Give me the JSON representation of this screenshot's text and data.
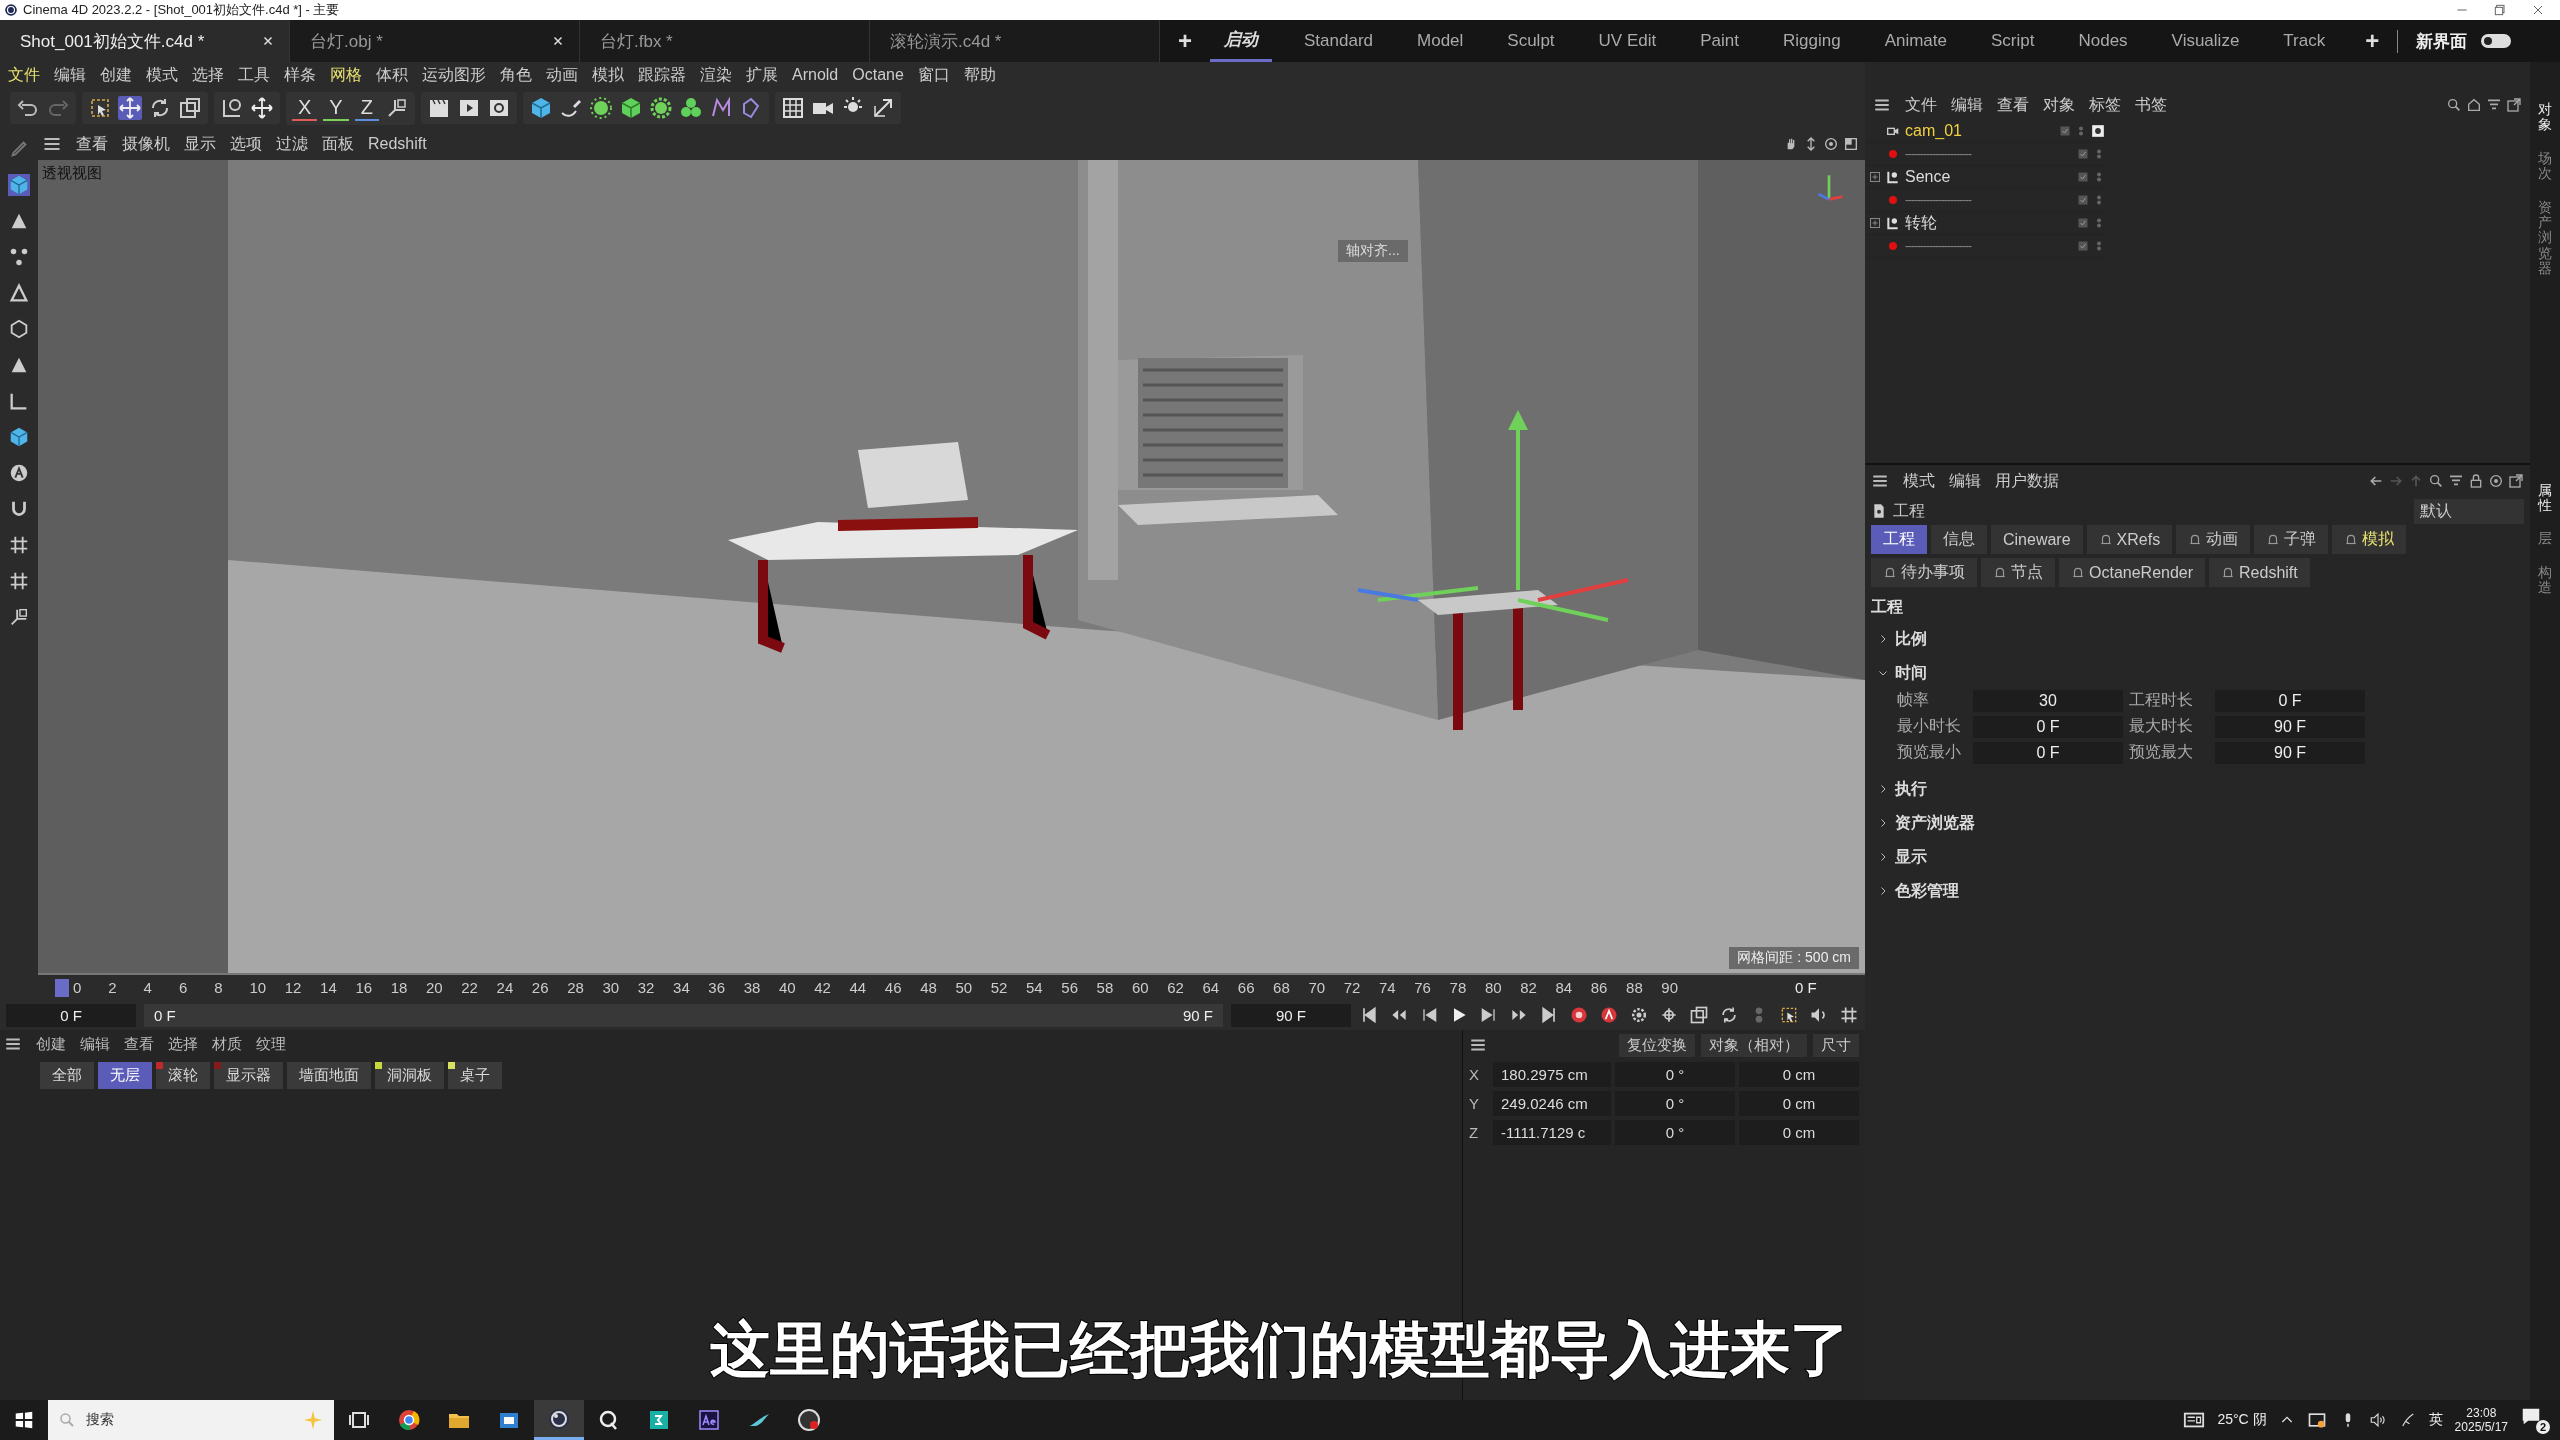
{
  "window": {
    "title": "Cinema 4D 2023.2.2 - [Shot_001初始文件.c4d *] - 主要"
  },
  "doc_tabs": [
    {
      "label": "Shot_001初始文件.c4d *",
      "selected": true,
      "closable": true
    },
    {
      "label": "台灯.obj *",
      "selected": false,
      "closable": true
    },
    {
      "label": "台灯.fbx *",
      "selected": false,
      "closable": false
    },
    {
      "label": "滚轮演示.c4d *",
      "selected": false,
      "closable": false
    }
  ],
  "new_tab": "+",
  "layouts": [
    {
      "label": "启动",
      "selected": true
    },
    {
      "label": "Standard",
      "selected": false
    },
    {
      "label": "Model",
      "selected": false
    },
    {
      "label": "Sculpt",
      "selected": false
    },
    {
      "label": "UV Edit",
      "selected": false
    },
    {
      "label": "Paint",
      "selected": false
    },
    {
      "label": "Rigging",
      "selected": false
    },
    {
      "label": "Animate",
      "selected": false
    },
    {
      "label": "Script",
      "selected": false
    },
    {
      "label": "Nodes",
      "selected": false
    },
    {
      "label": "Visualize",
      "selected": false
    },
    {
      "label": "Track",
      "selected": false
    }
  ],
  "add_layout": "+",
  "new_ui": {
    "label": "新界面",
    "on": false
  },
  "menu": [
    {
      "label": "文件",
      "highlighted": true
    },
    {
      "label": "编辑",
      "highlighted": false
    },
    {
      "label": "创建",
      "highlighted": false
    },
    {
      "label": "模式",
      "highlighted": false
    },
    {
      "label": "选择",
      "highlighted": false
    },
    {
      "label": "工具",
      "highlighted": false
    },
    {
      "label": "样条",
      "highlighted": false
    },
    {
      "label": "网格",
      "highlighted": true
    },
    {
      "label": "体积",
      "highlighted": false
    },
    {
      "label": "运动图形",
      "highlighted": false
    },
    {
      "label": "角色",
      "highlighted": false
    },
    {
      "label": "动画",
      "highlighted": false
    },
    {
      "label": "模拟",
      "highlighted": false
    },
    {
      "label": "跟踪器",
      "highlighted": false
    },
    {
      "label": "渲染",
      "highlighted": false
    },
    {
      "label": "扩展",
      "highlighted": false
    },
    {
      "label": "Arnold",
      "highlighted": false
    },
    {
      "label": "Octane",
      "highlighted": false
    },
    {
      "label": "窗口",
      "highlighted": false
    },
    {
      "label": "帮助",
      "highlighted": false
    }
  ],
  "axis_buttons": [
    {
      "label": "X",
      "color": "#e05a5a"
    },
    {
      "label": "Y",
      "color": "#7ccf5a"
    },
    {
      "label": "Z",
      "color": "#5a8ee0"
    }
  ],
  "viewport": {
    "menu": [
      "查看",
      "摄像机",
      "显示",
      "选项",
      "过滤",
      "面板",
      "Redshift"
    ],
    "view_name": "透视视图",
    "hint": "轴对齐...",
    "grid_spacing": "网格间距 : 500 cm"
  },
  "timeline": {
    "ticks": [
      "0",
      "2",
      "4",
      "6",
      "8",
      "10",
      "12",
      "14",
      "16",
      "18",
      "20",
      "22",
      "24",
      "26",
      "28",
      "30",
      "32",
      "34",
      "36",
      "38",
      "40",
      "42",
      "44",
      "46",
      "48",
      "50",
      "52",
      "54",
      "56",
      "58",
      "60",
      "62",
      "64",
      "66",
      "68",
      "70",
      "72",
      "74",
      "76",
      "78",
      "80",
      "82",
      "84",
      "86",
      "88",
      "90"
    ],
    "current_frame": "0 F",
    "start": "0 F",
    "range_bar": {
      "level": 1
    },
    "range_start": "0 F",
    "range_end": "90 F",
    "end": "90 F"
  },
  "layers": {
    "menu": [
      "创建",
      "编辑",
      "查看",
      "选择",
      "材质",
      "纹理"
    ],
    "chips": [
      {
        "label": "全部",
        "selected": false
      },
      {
        "label": "无层",
        "selected": true
      },
      {
        "label": "滚轮",
        "selected": false,
        "color": "#c0282a"
      },
      {
        "label": "显示器",
        "selected": false,
        "color": "#8a1a1a"
      },
      {
        "label": "墙面地面",
        "selected": false
      },
      {
        "label": "洞洞板",
        "selected": false,
        "color": "#c8d83a"
      },
      {
        "label": "桌子",
        "selected": false,
        "color": "#d8e060"
      }
    ]
  },
  "coordinates": {
    "reset": "复位变换",
    "mode": "对象（相对）",
    "size_mode": "尺寸",
    "rows": [
      {
        "axis": "X",
        "position": "180.2975 cm",
        "rotation": "0 °",
        "size": "0 cm"
      },
      {
        "axis": "Y",
        "position": "249.0246 cm",
        "rotation": "0 °",
        "size": "0 cm"
      },
      {
        "axis": "Z",
        "position": "-1111.7129 c",
        "rotation": "0 °",
        "size": "0 cm"
      }
    ]
  },
  "objects": {
    "menu": [
      "文件",
      "编辑",
      "查看",
      "对象",
      "标签",
      "书签"
    ],
    "items": [
      {
        "kind": "camera",
        "name": "cam_01",
        "highlighted": true
      },
      {
        "kind": "separator",
        "name": "----------------------",
        "highlighted": false
      },
      {
        "kind": "group",
        "name": "Sence",
        "highlighted": false
      },
      {
        "kind": "separator",
        "name": "----------------------",
        "highlighted": false
      },
      {
        "kind": "group",
        "name": "转轮",
        "highlighted": false
      },
      {
        "kind": "separator",
        "name": "----------------------",
        "highlighted": false
      }
    ]
  },
  "attributes": {
    "menu": [
      "模式",
      "编辑",
      "用户数据"
    ],
    "object": "工程",
    "preset": "默认",
    "tabs": [
      {
        "label": "工程",
        "selected": true,
        "pinned": false,
        "highlighted": false
      },
      {
        "label": "信息",
        "selected": false,
        "pinned": false,
        "highlighted": false
      },
      {
        "label": "Cineware",
        "selected": false,
        "pinned": false,
        "highlighted": false
      },
      {
        "label": "XRefs",
        "selected": false,
        "pinned": true,
        "highlighted": false
      },
      {
        "label": "动画",
        "selected": false,
        "pinned": true,
        "highlighted": false
      },
      {
        "label": "子弹",
        "selected": false,
        "pinned": true,
        "highlighted": false
      },
      {
        "label": "模拟",
        "selected": false,
        "pinned": true,
        "highlighted": true
      },
      {
        "label": "待办事项",
        "selected": false,
        "pinned": true,
        "highlighted": false
      },
      {
        "label": "节点",
        "selected": false,
        "pinned": true,
        "highlighted": false
      },
      {
        "label": "OctaneRender",
        "selected": false,
        "pinned": true,
        "highlighted": false
      },
      {
        "label": "Redshift",
        "selected": false,
        "pinned": true,
        "highlighted": false
      }
    ],
    "heading": "工程",
    "sections": [
      {
        "label": "比例",
        "expanded": false
      },
      {
        "label": "时间",
        "expanded": true,
        "fields": [
          {
            "label": "帧率",
            "value": "30"
          },
          {
            "label": "工程时长",
            "value": "0 F"
          },
          {
            "label": "最小时长",
            "value": "0 F"
          },
          {
            "label": "最大时长",
            "value": "90 F"
          },
          {
            "label": "预览最小",
            "value": "0 F"
          },
          {
            "label": "预览最大",
            "value": "90 F"
          }
        ]
      },
      {
        "label": "执行",
        "expanded": false
      },
      {
        "label": "资产浏览器",
        "expanded": false
      },
      {
        "label": "显示",
        "expanded": false
      },
      {
        "label": "色彩管理",
        "expanded": false
      }
    ]
  },
  "side_tabs": [
    {
      "label": "对象",
      "selected": true
    },
    {
      "label": "场次",
      "selected": false
    },
    {
      "label": "资产浏览器",
      "selected": false
    },
    {
      "label": "属性",
      "selected": true
    },
    {
      "label": "层",
      "selected": false
    },
    {
      "label": "构造",
      "selected": false
    }
  ],
  "subtitle": "这里的话我已经把我们的模型都导入进来了",
  "taskbar": {
    "search_placeholder": "搜索",
    "weather": "25°C 阴",
    "ime": "英",
    "time": "23:08",
    "date": "2025/5/17",
    "notifications": "2",
    "apps": [
      {
        "kind": "taskview",
        "active": false
      },
      {
        "kind": "chrome",
        "active": false
      },
      {
        "kind": "folder",
        "active": false
      },
      {
        "kind": "store",
        "active": false
      },
      {
        "kind": "cinema",
        "active": true
      },
      {
        "kind": "recorder",
        "active": false
      },
      {
        "kind": "max",
        "active": false
      },
      {
        "kind": "ae",
        "active": false
      },
      {
        "kind": "bird",
        "active": false
      },
      {
        "kind": "obs",
        "active": false
      }
    ]
  }
}
